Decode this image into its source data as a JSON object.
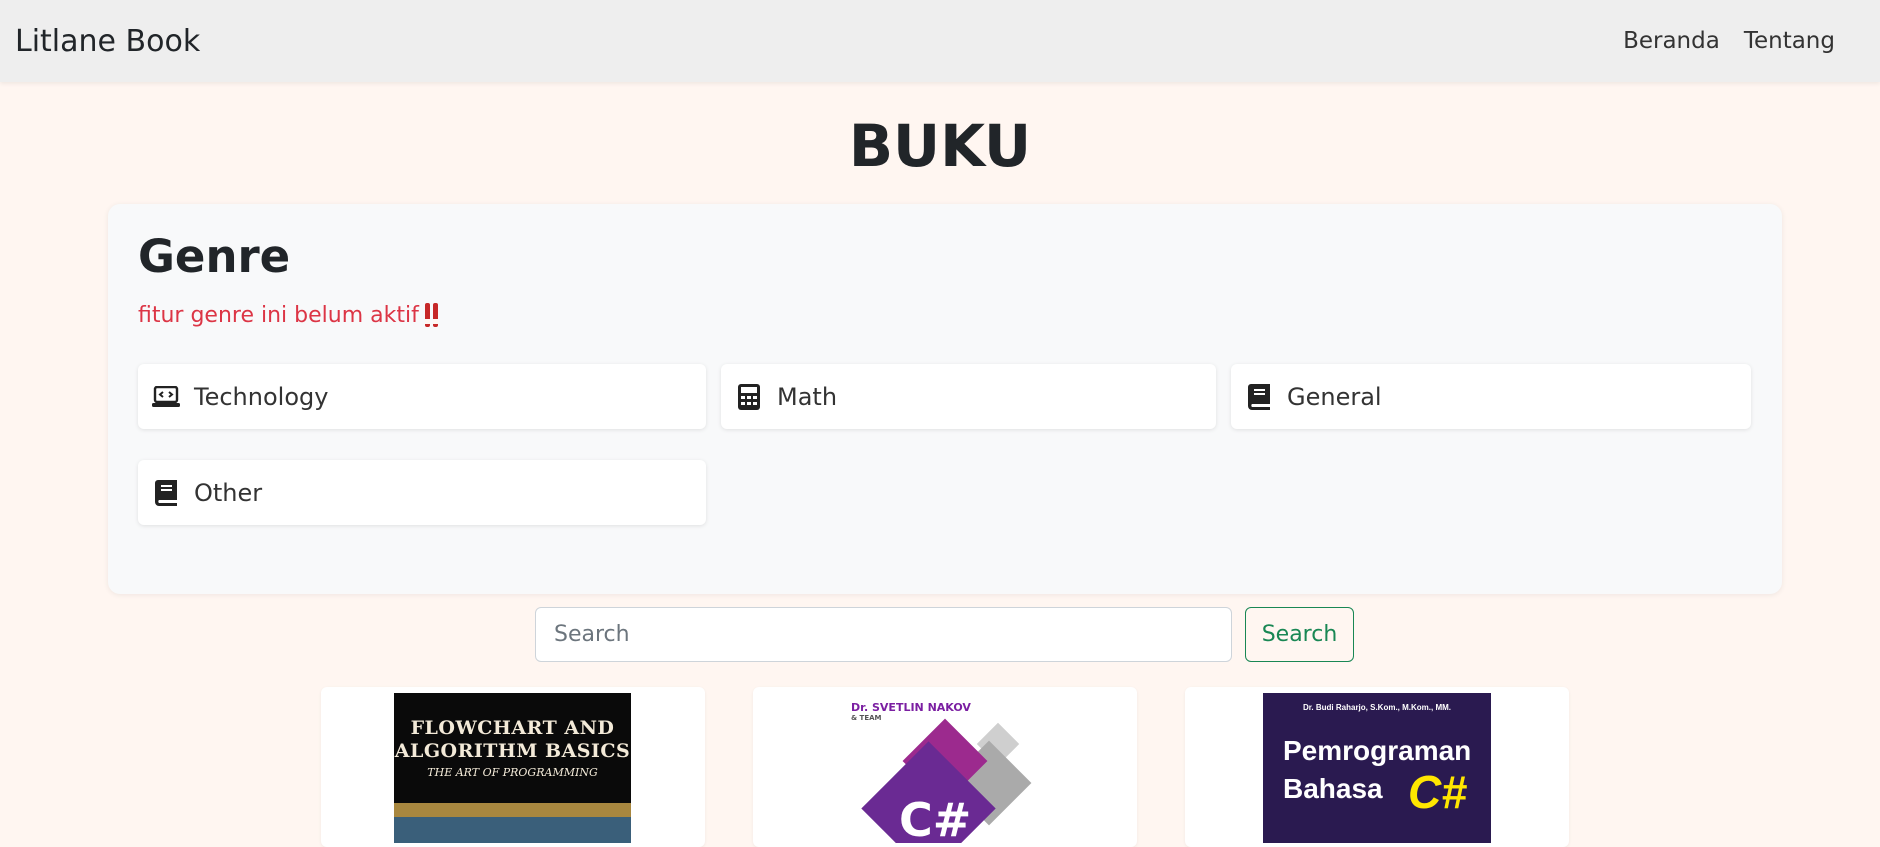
{
  "navbar": {
    "brand": "Litlane Book",
    "links": [
      "Beranda",
      "Tentang"
    ]
  },
  "page": {
    "title": "BUKU"
  },
  "genre": {
    "title": "Genre",
    "note": "fitur genre ini belum aktif",
    "items": [
      {
        "label": "Technology",
        "icon": "laptop-code-icon"
      },
      {
        "label": "Math",
        "icon": "calculator-icon"
      },
      {
        "label": "General",
        "icon": "book-icon"
      },
      {
        "label": "Other",
        "icon": "book-icon"
      }
    ]
  },
  "search": {
    "placeholder": "Search",
    "button_label": "Search"
  },
  "books": [
    {
      "cover_title_1": "Flowchart and",
      "cover_title_2": "Algorithm Basics",
      "cover_subtitle": "The Art of Programming"
    },
    {
      "cover_author": "Dr. SVETLIN NAKOV",
      "cover_team": "& TEAM",
      "cover_title": "C#"
    },
    {
      "cover_author": "Dr. Budi Raharjo, S.Kom., M.Kom., MM.",
      "cover_title_1": "Pemrograman",
      "cover_title_2": "Bahasa",
      "cover_title_3": "C#"
    }
  ],
  "colors": {
    "background": "#fff6f1",
    "navbar": "#eeeeee",
    "warning_text": "#dc3545",
    "search_button": "#198754"
  }
}
